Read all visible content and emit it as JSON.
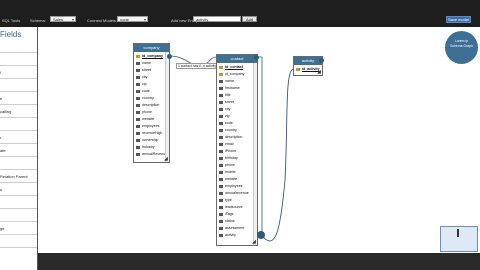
{
  "toolbar": {
    "logo_text": "SQL Tools",
    "schema_label": "Schema:",
    "schema_value": "Sales",
    "connect_label": "Connect Models:",
    "connect_value": "none",
    "add_table_label": "Add new Entity:",
    "add_table_value": "activity",
    "add_button": "Add",
    "save_button": "Save model"
  },
  "sidebar": {
    "title": "Fields",
    "rows": [
      "",
      "",
      "l",
      "",
      "e",
      "calling",
      "",
      "r",
      "ate",
      "",
      "Relation Parent",
      "s",
      "",
      "",
      "ge",
      ""
    ]
  },
  "tables": {
    "company": {
      "title": "company",
      "fields": [
        "id_company",
        "name",
        "street",
        "city",
        "zip",
        "code",
        "country",
        "description",
        "phone",
        "website",
        "employees",
        "revenueHigh",
        "ownership",
        "industry",
        "annualRevenue"
      ]
    },
    "contact": {
      "title": "contact",
      "fields": [
        "id_contact",
        "id_company",
        "name",
        "firstname",
        "title",
        "street",
        "city",
        "zip",
        "code",
        "country",
        "description",
        "email",
        "iPhone",
        "birthday",
        "phone",
        "mobile",
        "website",
        "employees",
        "annualrevenue",
        "type",
        "leadsource",
        "iTags",
        "status",
        "assessment",
        "activity"
      ]
    },
    "activity": {
      "title": "activity",
      "fields": [
        "id_activity"
      ]
    }
  },
  "relation": {
    "label": "1 contact has 0..n activity"
  },
  "widget": {
    "line1": "Lorem ip",
    "line2": "Schema Graph"
  },
  "colors": {
    "header": "#3e6f94",
    "accent": "#3b6ea8",
    "link": "#2d5b7c"
  }
}
